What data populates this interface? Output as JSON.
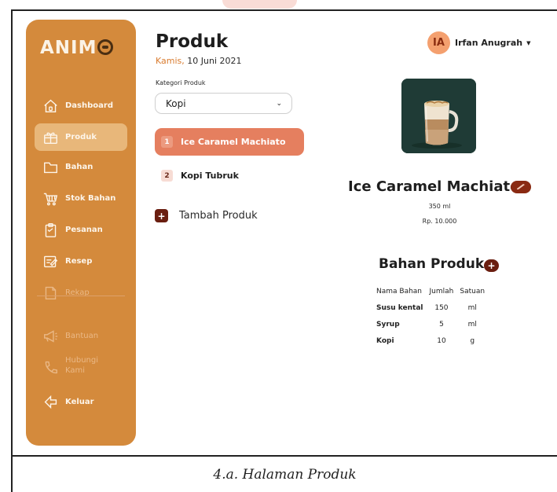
{
  "brand": {
    "logo_text": "ANIM",
    "logo_mark": "O"
  },
  "sidebar": {
    "items": [
      {
        "label": "Dashboard",
        "icon": "home-icon"
      },
      {
        "label": "Produk",
        "icon": "gift-icon"
      },
      {
        "label": "Bahan",
        "icon": "folder-icon"
      },
      {
        "label": "Stok Bahan",
        "icon": "cart-icon"
      },
      {
        "label": "Pesanan",
        "icon": "clipboard-icon"
      },
      {
        "label": "Resep",
        "icon": "recipe-icon"
      },
      {
        "label": "Rekap",
        "icon": "document-icon"
      },
      {
        "label": "Bantuan",
        "icon": "megaphone-icon"
      },
      {
        "label": "Hubungi\nKami",
        "icon": "phone-icon"
      },
      {
        "label": "Keluar",
        "icon": "logout-icon"
      }
    ]
  },
  "header": {
    "title": "Produk",
    "date_day": "Kamis,",
    "date_rest": " 10 Juni 2021"
  },
  "category": {
    "label": "Kategori Produk",
    "selected": "Kopi"
  },
  "products": [
    {
      "num": "1",
      "name": "Ice Caramel Machiato"
    },
    {
      "num": "2",
      "name": "Kopi Tubruk"
    }
  ],
  "add_product": {
    "icon": "+",
    "label": "Tambah Produk"
  },
  "user": {
    "initials": "IA",
    "name": "Irfan Anugrah"
  },
  "detail": {
    "name": "Ice Caramel Machiato",
    "size": "350 ml",
    "price": "Rp. 10.000"
  },
  "ingredients": {
    "title": "Bahan Produk",
    "add_icon": "+",
    "columns": [
      "Nama Bahan",
      "Jumlah",
      "Satuan"
    ],
    "rows": [
      [
        "Susu kental",
        "150",
        "ml"
      ],
      [
        "Syrup",
        "5",
        "ml"
      ],
      [
        "Kopi",
        "10",
        "g"
      ]
    ]
  },
  "caption": "4.a.  Halaman Produk",
  "colors": {
    "sidebar": "#d48a3c",
    "accent": "#e57f5f",
    "date_accent": "#d97b2e",
    "dark_button": "#6a1e10"
  }
}
